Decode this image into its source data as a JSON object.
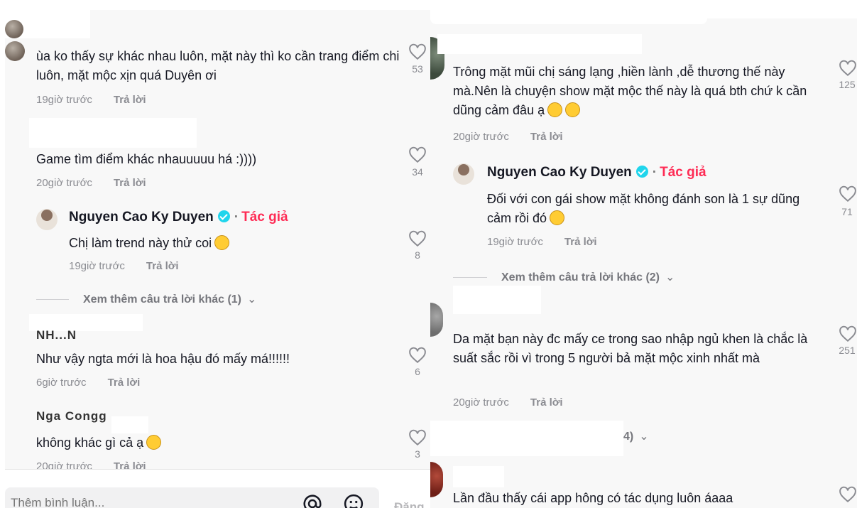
{
  "left_panel": {
    "comments": [
      {
        "username": "",
        "text": "ùa ko thấy sự khác nhau luôn, mặt này thì ko cần trang điểm chi luôn, mặt mộc xịn quá Duyên ơi",
        "time": "19giờ trước",
        "reply_label": "Trả lời",
        "likes": "53"
      },
      {
        "username": "",
        "text": "Game tìm điểm khác nhauuuuu há :))))",
        "time": "20giờ trước",
        "reply_label": "Trả lời",
        "likes": "34"
      },
      {
        "username": "Nguyen Cao Ky Duyen",
        "author_tag": "Tác giả",
        "text": "Chị làm trend này thử coi",
        "time": "19giờ trước",
        "reply_label": "Trả lời",
        "likes": "8"
      },
      {
        "username": "Như vậy ngta mới là hoa hậu đó mấy má!!!!!!",
        "text": "Như vậy ngta mới là hoa hậu đó mấy má!!!!!!",
        "time": "6giờ trước",
        "reply_label": "Trả lời",
        "likes": "6"
      },
      {
        "username": "",
        "text": "không khác gì cả ạ",
        "time": "20giờ trước",
        "reply_label": "Trả lời",
        "likes": "3"
      }
    ],
    "view_more": "Xem thêm câu trả lời khác (1)",
    "partial_name_1": "NH...N",
    "partial_name_2": "Nga Congg"
  },
  "right_panel": {
    "comments": [
      {
        "text": "Trông mặt mũi chị sáng lạng ,hiền lành ,dễ thương thế này mà.Nên là chuyện show mặt mộc thế này là quá bth chứ k cần dũng cảm đâu ạ",
        "time": "20giờ trước",
        "reply_label": "Trả lời",
        "likes": "125"
      },
      {
        "username": "Nguyen Cao Ky Duyen",
        "author_tag": "Tác giả",
        "text": "Đối với con gái show mặt không đánh son là 1 sự dũng cảm rồi đó",
        "time": "19giờ trước",
        "reply_label": "Trả lời",
        "likes": "71"
      },
      {
        "text": "Da mặt bạn này đc mấy ce trong sao nhập ngủ khen là chắc là suất sắc rồi vì trong 5 người bả mặt mộc xinh nhất mà",
        "time": "20giờ trước",
        "reply_label": "Trả lời",
        "likes": "251"
      },
      {
        "text": "Lần đầu thấy cái app hông có tác dụng luôn áaaa",
        "likes": ""
      }
    ],
    "view_more": "Xem thêm câu trả lời khác (2)",
    "partial_count": "4)"
  },
  "composer": {
    "placeholder": "Thêm bình luận...",
    "post_label": "Đăng",
    "at_icon": "at-icon",
    "emoji_icon": "emoji-icon"
  },
  "colors": {
    "author_red": "#fe2c55",
    "verified": "#20d5ec",
    "muted": "#8a8b91"
  }
}
